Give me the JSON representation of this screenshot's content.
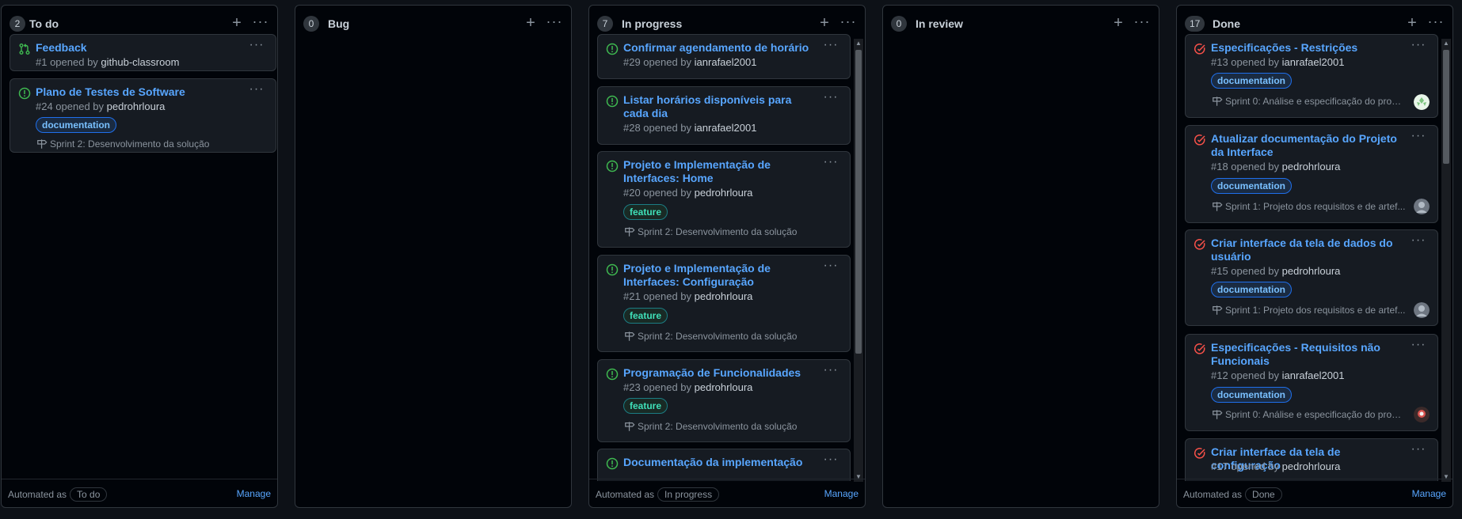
{
  "board": {
    "columns": [
      {
        "count": "2",
        "title": "To do",
        "automated_label": "Automated as",
        "automated_value": "To do",
        "manage": "Manage",
        "cards": [
          {
            "title": "Feedback",
            "state": "pull-request-open",
            "number": "#1 opened by",
            "user": "github-classroom"
          },
          {
            "title": "Plano de Testes de Software",
            "state": "issue-open",
            "number": "#24 opened by",
            "user": "pedrohrloura",
            "label": "documentation",
            "milestone": "Sprint 2: Desenvolvimento da solução"
          }
        ]
      },
      {
        "count": "0",
        "title": "Bug",
        "automated_label": "",
        "automated_value": "",
        "manage": "",
        "cards": []
      },
      {
        "count": "7",
        "title": "In progress",
        "automated_label": "Automated as",
        "automated_value": "In progress",
        "manage": "Manage",
        "cards": [
          {
            "title": "Confirmar agendamento de horário",
            "state": "issue-open",
            "number": "#29 opened by",
            "user": "ianrafael2001"
          },
          {
            "title": "Listar horários disponíveis para cada dia",
            "state": "issue-open",
            "number": "#28 opened by",
            "user": "ianrafael2001"
          },
          {
            "title": "Projeto e Implementação de Interfaces: Home",
            "state": "issue-open",
            "number": "#20 opened by",
            "user": "pedrohrloura",
            "label": "feature",
            "milestone": "Sprint 2: Desenvolvimento da solução"
          },
          {
            "title": "Projeto e Implementação de Interfaces: Configuração",
            "state": "issue-open",
            "number": "#21 opened by",
            "user": "pedrohrloura",
            "label": "feature",
            "milestone": "Sprint 2: Desenvolvimento da solução"
          },
          {
            "title": "Programação de Funcionalidades",
            "state": "issue-open",
            "number": "#23 opened by",
            "user": "pedrohrloura",
            "label": "feature",
            "milestone": "Sprint 2: Desenvolvimento da solução"
          },
          {
            "title": "Documentação da implementação",
            "state": "issue-open"
          }
        ]
      },
      {
        "count": "0",
        "title": "In review",
        "automated_label": "",
        "automated_value": "",
        "manage": "",
        "cards": []
      },
      {
        "count": "17",
        "title": "Done",
        "automated_label": "Automated as",
        "automated_value": "Done",
        "manage": "Manage",
        "cards": [
          {
            "title": "Especificações - Restrições",
            "state": "issue-closed",
            "number": "#13 opened by",
            "user": "ianrafael2001",
            "label": "documentation",
            "milestone": "Sprint 0: Análise e especificação do probl..."
          },
          {
            "title": "Atualizar documentação do Projeto da Interface",
            "state": "issue-closed",
            "number": "#18 opened by",
            "user": "pedrohrloura",
            "label": "documentation",
            "milestone": "Sprint 1: Projeto dos requisitos e de artef..."
          },
          {
            "title": "Criar interface da tela de dados do usuário",
            "state": "issue-closed",
            "number": "#15 opened by",
            "user": "pedrohrloura",
            "label": "documentation",
            "milestone": "Sprint 1: Projeto dos requisitos e de artef..."
          },
          {
            "title": "Especificações - Requisitos não Funcionais",
            "state": "issue-closed",
            "number": "#12 opened by",
            "user": "ianrafael2001",
            "label": "documentation",
            "milestone": "Sprint 0: Análise e especificação do probl..."
          },
          {
            "title": "Criar interface da tela de configuração",
            "state": "issue-closed",
            "number": "#17 opened by",
            "user": "pedrohrloura"
          }
        ]
      }
    ]
  },
  "colors": {
    "background": "#0d1117",
    "card": "#161b22",
    "accent_link": "#58a6ff",
    "open_issue": "#3fb950",
    "closed_issue": "#f85149",
    "label_documentation": "#79c0ff",
    "label_feature": "#3fe0b8"
  },
  "icons": {
    "add": "plus-icon",
    "menu": "kebab-horizontal-icon",
    "milestone": "milestone-icon",
    "pull_request": "git-pull-request-icon",
    "open_issue": "issue-opened-icon",
    "closed_issue": "issue-closed-icon"
  }
}
